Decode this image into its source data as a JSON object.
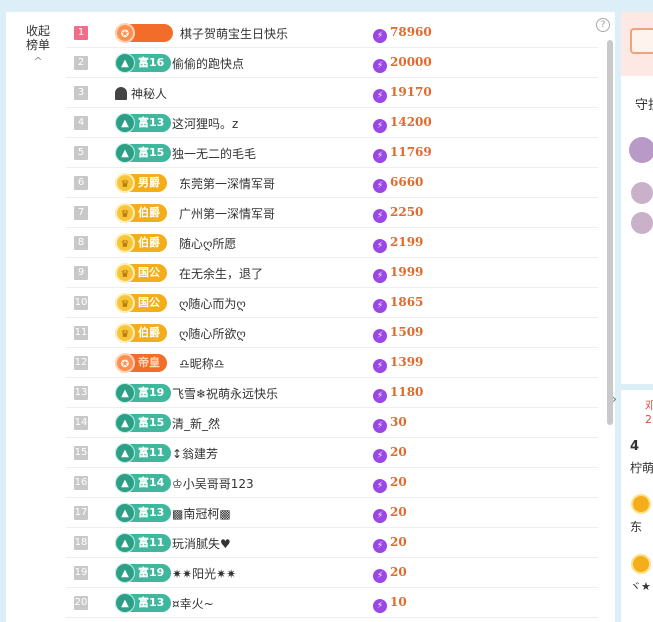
{
  "collapse": {
    "line1": "收起",
    "line2": "榜单",
    "chevron": "^"
  },
  "help": "?",
  "rows": [
    {
      "rank": "1",
      "badge_type": "di-plain",
      "badge_text": "",
      "name": "棋子贺萌宝生日快乐",
      "score": "78960"
    },
    {
      "rank": "2",
      "badge_type": "fu",
      "badge_text": "富16",
      "name": "偷偷的跑快点",
      "score": "20000"
    },
    {
      "rank": "3",
      "badge_type": "none",
      "badge_text": "",
      "name": "神秘人",
      "score": "19170"
    },
    {
      "rank": "4",
      "badge_type": "fu",
      "badge_text": "富13",
      "name": "这河狸吗。z",
      "score": "14200"
    },
    {
      "rank": "5",
      "badge_type": "fu",
      "badge_text": "富15",
      "name": "独一无二的毛毛",
      "score": "11769"
    },
    {
      "rank": "6",
      "badge_type": "jue",
      "badge_text": "男爵",
      "name": "东莞第一深情军哥",
      "score": "6660"
    },
    {
      "rank": "7",
      "badge_type": "jue",
      "badge_text": "伯爵",
      "name": "广州第一深情军哥",
      "score": "2250"
    },
    {
      "rank": "8",
      "badge_type": "jue",
      "badge_text": "伯爵",
      "name": "随心ღ所愿",
      "score": "2199"
    },
    {
      "rank": "9",
      "badge_type": "jue",
      "badge_text": "国公",
      "name": "在无余生，退了",
      "score": "1999"
    },
    {
      "rank": "10",
      "badge_type": "jue",
      "badge_text": "国公",
      "name": "ღ随心而为ღ",
      "score": "1865"
    },
    {
      "rank": "11",
      "badge_type": "jue",
      "badge_text": "伯爵",
      "name": "ღ随心所欲ღ",
      "score": "1509"
    },
    {
      "rank": "12",
      "badge_type": "di",
      "badge_text": "帝皇",
      "name": "♎昵称♎",
      "score": "1399"
    },
    {
      "rank": "13",
      "badge_type": "fu",
      "badge_text": "富19",
      "name": "飞雪❄祝萌永远快乐",
      "score": "1180"
    },
    {
      "rank": "14",
      "badge_type": "fu",
      "badge_text": "富15",
      "name": "清_新_然",
      "score": "30"
    },
    {
      "rank": "15",
      "badge_type": "fu",
      "badge_text": "富11",
      "name": "↕翁建芳",
      "score": "20"
    },
    {
      "rank": "16",
      "badge_type": "fu",
      "badge_text": "富14",
      "name": "♔小吴哥哥123",
      "score": "20"
    },
    {
      "rank": "17",
      "badge_type": "fu",
      "badge_text": "富13",
      "name": "▩南冠柯▩",
      "score": "20"
    },
    {
      "rank": "18",
      "badge_type": "fu",
      "badge_text": "富11",
      "name": "玩消腻失♥",
      "score": "20"
    },
    {
      "rank": "19",
      "badge_type": "fu",
      "badge_text": "富19",
      "name": "✷✷阳光✷✷",
      "score": "20"
    },
    {
      "rank": "20",
      "badge_type": "fu",
      "badge_text": "富13",
      "name": "¤幸火~",
      "score": "10"
    }
  ],
  "side": {
    "tab": "守护",
    "text1": "邓",
    "text1b": "2",
    "text2": "4",
    "text3": "柠萌",
    "text4": "东",
    "text5": "ヾ★"
  }
}
